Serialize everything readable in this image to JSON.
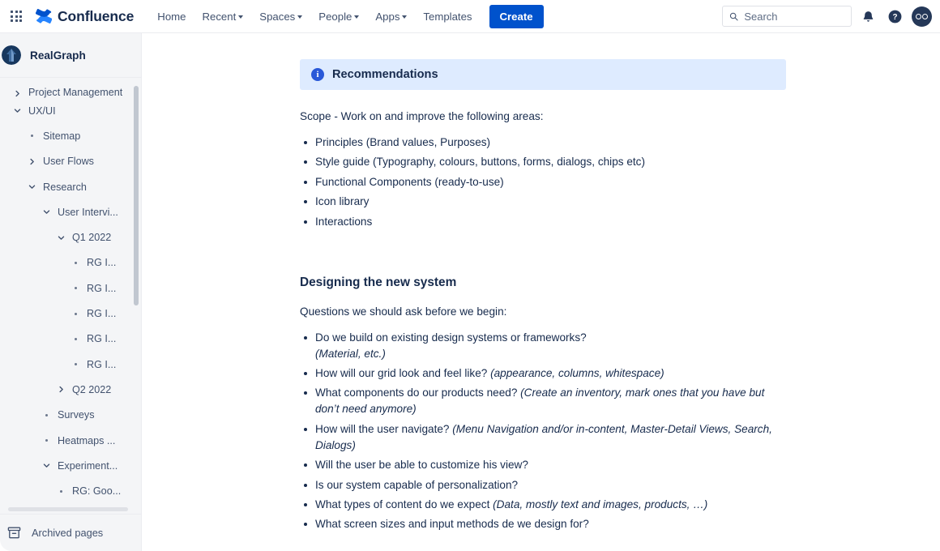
{
  "topnav": {
    "app_switcher_icon": "grid-apps-icon",
    "product_name": "Confluence",
    "logo_icon": "confluence-logo-icon",
    "items": [
      {
        "label": "Home",
        "has_caret": false
      },
      {
        "label": "Recent",
        "has_caret": true
      },
      {
        "label": "Spaces",
        "has_caret": true
      },
      {
        "label": "People",
        "has_caret": true
      },
      {
        "label": "Apps",
        "has_caret": true
      },
      {
        "label": "Templates",
        "has_caret": false
      }
    ],
    "create_label": "Create",
    "search": {
      "placeholder": "Search",
      "value": "",
      "icon": "search-icon"
    },
    "notifications_icon": "bell-icon",
    "help_icon": "question-circle-icon",
    "avatar_icon": "user-avatar"
  },
  "sidebar": {
    "space_name": "RealGraph",
    "space_logo_icon": "realgraph-space-logo",
    "tree": [
      {
        "label": "Project Management",
        "indent": 0,
        "marker": "chevron-right",
        "partial": true
      },
      {
        "label": "UX/UI",
        "indent": 0,
        "marker": "chevron-down"
      },
      {
        "label": "Sitemap",
        "indent": 1,
        "marker": "dot"
      },
      {
        "label": "User Flows",
        "indent": 1,
        "marker": "chevron-right"
      },
      {
        "label": "Research",
        "indent": 1,
        "marker": "chevron-down"
      },
      {
        "label": "User Intervi...",
        "indent": 2,
        "marker": "chevron-down"
      },
      {
        "label": "Q1 2022",
        "indent": 3,
        "marker": "chevron-down"
      },
      {
        "label": "RG I...",
        "indent": 4,
        "marker": "dot"
      },
      {
        "label": "RG I...",
        "indent": 4,
        "marker": "dot"
      },
      {
        "label": "RG I...",
        "indent": 4,
        "marker": "dot"
      },
      {
        "label": "RG I...",
        "indent": 4,
        "marker": "dot"
      },
      {
        "label": "RG I...",
        "indent": 4,
        "marker": "dot"
      },
      {
        "label": "Q2 2022",
        "indent": 3,
        "marker": "chevron-right"
      },
      {
        "label": "Surveys",
        "indent": 2,
        "marker": "dot"
      },
      {
        "label": "Heatmaps ...",
        "indent": 2,
        "marker": "dot"
      },
      {
        "label": "Experiment...",
        "indent": 2,
        "marker": "chevron-down"
      },
      {
        "label": "RG: Goo...",
        "indent": 3,
        "marker": "dot"
      }
    ],
    "archived_label": "Archived pages",
    "archived_icon": "archive-box-icon"
  },
  "page": {
    "panel": {
      "icon": "info-icon",
      "title": "Recommendations"
    },
    "scope_intro": "Scope - Work on and improve the following areas:",
    "scope_items": [
      "Principles (Brand values, Purposes)",
      "Style guide (Typography, colours, buttons, forms, dialogs, chips etc)",
      "Functional Components (ready-to-use)",
      "Icon library",
      "Interactions"
    ],
    "section_heading": "Designing the new system",
    "questions_intro": "Questions we should ask before we begin:",
    "questions": [
      {
        "text": "Do we build on existing design systems or frameworks?",
        "note": "(Material, etc.)",
        "note_on_new_line": true
      },
      {
        "text": "How will our grid look and feel like? ",
        "note": "(appearance, columns, whitespace)",
        "note_on_new_line": false
      },
      {
        "text": "What components do our products need? ",
        "note": "(Create an inventory, mark ones that you have but don’t need anymore)",
        "note_on_new_line": false
      },
      {
        "text": "How will the user navigate? ",
        "note": "(Menu Navigation and/or in-content, Master-Detail Views, Search, Dialogs)",
        "note_on_new_line": false
      },
      {
        "text": "Will the user be able to customize his view?",
        "note": "",
        "note_on_new_line": false
      },
      {
        "text": "Is our system capable of personalization?",
        "note": "",
        "note_on_new_line": false
      },
      {
        "text": "What types of content do we expect ",
        "note": "(Data, mostly text and images, products, …)",
        "note_on_new_line": false
      },
      {
        "text": "What screen sizes and input methods de we design for?",
        "note": "",
        "note_on_new_line": false
      }
    ]
  },
  "colors": {
    "brand_blue": "#0052CC",
    "panel_bg": "#DEEBFF",
    "text": "#172B4D",
    "muted_text": "#42526E",
    "sidebar_bg": "#F4F5F7",
    "avatar_bg": "#253858"
  }
}
